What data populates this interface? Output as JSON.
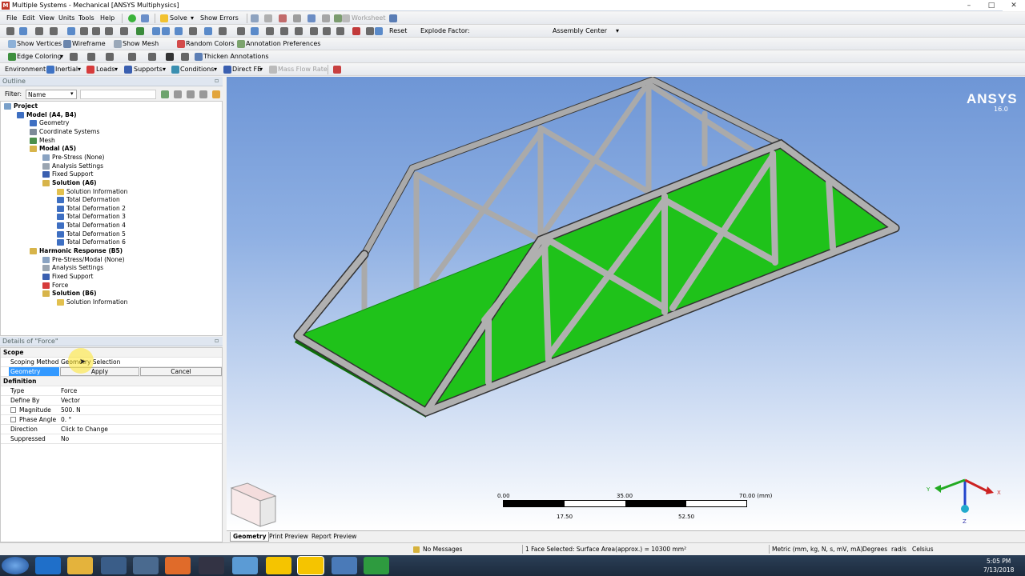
{
  "window": {
    "title": "Multiple Systems - Mechanical [ANSYS Multiphysics]",
    "app_icon": "M",
    "minimize": "–",
    "maximize": "□",
    "close": "✕"
  },
  "menu": {
    "items": [
      "File",
      "Edit",
      "View",
      "Units",
      "Tools",
      "Help"
    ],
    "solve": "Solve",
    "show_errors": "Show Errors",
    "worksheet": "Worksheet"
  },
  "toolbar2": {
    "reset": "Reset",
    "explode_factor": "Explode Factor:",
    "assembly_center": "Assembly Center"
  },
  "toolbar3": {
    "show_vertices": "Show Vertices",
    "wireframe": "Wireframe",
    "show_mesh": "Show Mesh",
    "random_colors": "Random Colors",
    "annotation_preferences": "Annotation Preferences"
  },
  "toolbar4": {
    "edge_coloring": "Edge Coloring",
    "thicken_annotations": "Thicken Annotations"
  },
  "context_toolbar": {
    "environment": "Environment",
    "inertial": "Inertial",
    "loads": "Loads",
    "supports": "Supports",
    "conditions": "Conditions",
    "direct_fe": "Direct FE",
    "mass_flow_rate": "Mass Flow Rate"
  },
  "outline": {
    "header": "Outline",
    "filter_label": "Filter:",
    "filter_value": "Name",
    "tree": [
      {
        "label": "Project",
        "bold": true
      },
      {
        "label": "Model (A4, B4)",
        "bold": true
      },
      {
        "label": "Geometry",
        "bold": false
      },
      {
        "label": "Coordinate Systems",
        "bold": false
      },
      {
        "label": "Mesh",
        "bold": false
      },
      {
        "label": "Modal (A5)",
        "bold": true
      },
      {
        "label": "Pre-Stress (None)",
        "bold": false
      },
      {
        "label": "Analysis Settings",
        "bold": false
      },
      {
        "label": "Fixed Support",
        "bold": false
      },
      {
        "label": "Solution (A6)",
        "bold": true
      },
      {
        "label": "Solution Information",
        "bold": false
      },
      {
        "label": "Total Deformation",
        "bold": false
      },
      {
        "label": "Total Deformation 2",
        "bold": false
      },
      {
        "label": "Total Deformation 3",
        "bold": false
      },
      {
        "label": "Total Deformation 4",
        "bold": false
      },
      {
        "label": "Total Deformation 5",
        "bold": false
      },
      {
        "label": "Total Deformation 6",
        "bold": false
      },
      {
        "label": "Harmonic Response (B5)",
        "bold": true
      },
      {
        "label": "Pre-Stress/Modal (None)",
        "bold": false
      },
      {
        "label": "Analysis Settings",
        "bold": false
      },
      {
        "label": "Fixed Support",
        "bold": false
      },
      {
        "label": "Force",
        "bold": false
      },
      {
        "label": "Solution (B6)",
        "bold": true
      },
      {
        "label": "Solution Information",
        "bold": false
      }
    ]
  },
  "details": {
    "header": "Details of \"Force\"",
    "scope_section": "Scope",
    "scoping_method_label": "Scoping Method",
    "scoping_method_value": "Geometry Selection",
    "geometry_label": "Geometry",
    "apply": "Apply",
    "cancel": "Cancel",
    "definition_section": "Definition",
    "type_label": "Type",
    "type_value": "Force",
    "define_by_label": "Define By",
    "define_by_value": "Vector",
    "magnitude_label": "Magnitude",
    "magnitude_value": "500. N",
    "phase_angle_label": "Phase Angle",
    "phase_angle_value": "0. °",
    "direction_label": "Direction",
    "direction_value": "Click to Change",
    "suppressed_label": "Suppressed",
    "suppressed_value": "No"
  },
  "viewport": {
    "logo": "ANSYS",
    "version": "16.0",
    "scale_top": [
      "0.00",
      "35.00",
      "70.00 (mm)"
    ],
    "scale_bottom": [
      "17.50",
      "52.50"
    ],
    "axis_x": "X",
    "axis_y": "Y",
    "axis_z": "Z",
    "tabs": [
      "Geometry",
      "Print Preview",
      "Report Preview"
    ],
    "colors": {
      "deck": "#1fc21a",
      "truss": "#a9a9a9",
      "background_top": "#6e96d6"
    }
  },
  "status": {
    "messages": "No Messages",
    "selection": "1 Face Selected: Surface Area(approx.) = 10300 mm²",
    "units": "Metric (mm, kg, N, s, mV, mA)",
    "degrees": "Degrees",
    "rads": "rad/s",
    "celsius": "Celsius"
  },
  "taskbar": {
    "time": "5:05 PM",
    "date": "7/13/2018"
  }
}
